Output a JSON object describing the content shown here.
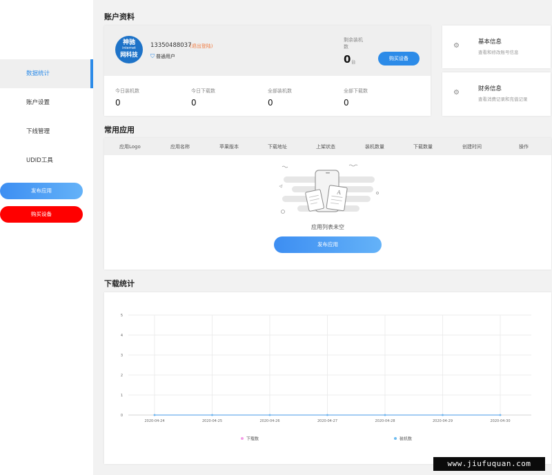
{
  "sidebar": {
    "items": [
      {
        "label": "数据统计",
        "active": true
      },
      {
        "label": "账户设置",
        "active": false
      },
      {
        "label": "下线管理",
        "active": false
      },
      {
        "label": "UDID工具",
        "active": false
      }
    ],
    "publish_label": "发布应用",
    "buy_label": "购买设备"
  },
  "account": {
    "section_title": "账户资料",
    "avatar_line1": "神驰",
    "avatar_line2": "internet",
    "avatar_line3": "网科技",
    "phone": "13350488037",
    "logout_label": "(退出登陆)",
    "user_type": "普通用户",
    "remaining_label": "剩余装机数",
    "remaining_value": "0",
    "remaining_unit": "台",
    "buy_button": "购买设备",
    "stats": [
      {
        "label": "今日装机数",
        "value": "0"
      },
      {
        "label": "今日下载数",
        "value": "0"
      },
      {
        "label": "全部装机数",
        "value": "0"
      },
      {
        "label": "全部下载数",
        "value": "0"
      }
    ]
  },
  "info_cards": [
    {
      "title": "基本信息",
      "desc": "查看和修改账号信息",
      "icon": "gear-icon"
    },
    {
      "title": "财务信息",
      "desc": "查看消费记录和充值记录",
      "icon": "gear-icon"
    }
  ],
  "apps": {
    "section_title": "常用应用",
    "columns": [
      "应用Logo",
      "应用名称",
      "苹果版本",
      "下载地址",
      "上架状态",
      "装机数量",
      "下载数量",
      "创建时间",
      "操作"
    ],
    "empty_text": "应用列表未空",
    "publish_button": "发布应用"
  },
  "downloads": {
    "section_title": "下载统计"
  },
  "chart_data": {
    "type": "line",
    "x": [
      "2020-04-24",
      "2020-04-25",
      "2020-04-26",
      "2020-04-27",
      "2020-04-28",
      "2020-04-29",
      "2020-04-30"
    ],
    "series": [
      {
        "name": "下载数",
        "values": [
          0,
          0,
          0,
          0,
          0,
          0,
          0
        ],
        "color": "#f39ee6"
      },
      {
        "name": "装机数",
        "values": [
          0,
          0,
          0,
          0,
          0,
          0,
          0
        ],
        "color": "#6cbbf0"
      }
    ],
    "yticks": [
      "0",
      "1",
      "2",
      "3",
      "4",
      "5"
    ],
    "ylim": [
      0,
      5
    ],
    "grid": true,
    "legend_position": "bottom"
  },
  "watermark": "www.jiufuquan.com"
}
